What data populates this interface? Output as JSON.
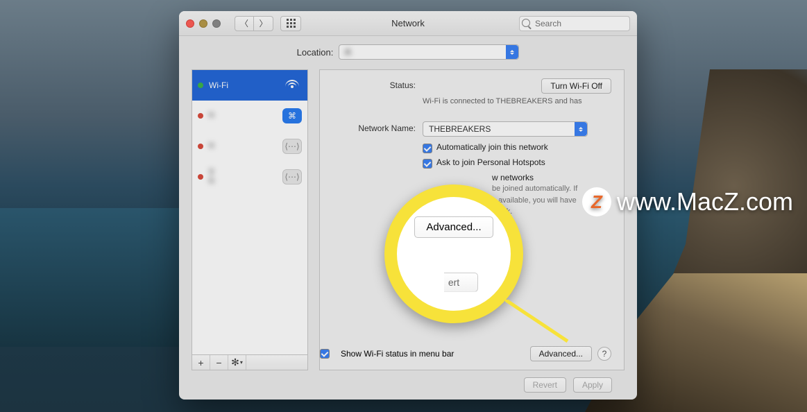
{
  "window": {
    "title": "Network"
  },
  "search": {
    "placeholder": "Search"
  },
  "location": {
    "label": "Location:",
    "value": "A"
  },
  "sidebar": {
    "items": [
      {
        "name": "Wi-Fi",
        "sub": ""
      },
      {
        "name": "",
        "sub": "N"
      },
      {
        "name": "",
        "sub": "N"
      },
      {
        "name": "T",
        "sub": "N"
      }
    ],
    "add": "+",
    "remove": "−",
    "gear": "✻"
  },
  "status": {
    "label": "Status:",
    "value": "",
    "turn_off": "Turn Wi-Fi Off",
    "desc_line1": "Wi-Fi is connected to THEBREAKERS and has",
    "desc_line2": ""
  },
  "network_name": {
    "label": "Network Name:",
    "value": "THEBREAKERS"
  },
  "checks": {
    "auto_join": "Automatically join this network",
    "ask_hotspot": "Ask to join Personal Hotspots",
    "ask_networks": "w networks",
    "ask_hint1": "be joined automatically. If",
    "ask_hint2": "e available, you will have",
    "ask_hint3": "twork."
  },
  "show_menu": "Show Wi-Fi status in menu bar",
  "buttons": {
    "advanced": "Advanced...",
    "advanced_mag": "Advanced...",
    "revert": "Revert",
    "apply": "Apply",
    "revert_mag": "ert",
    "help": "?"
  },
  "watermark": {
    "badge": "Z",
    "text": "www.MacZ.com"
  }
}
